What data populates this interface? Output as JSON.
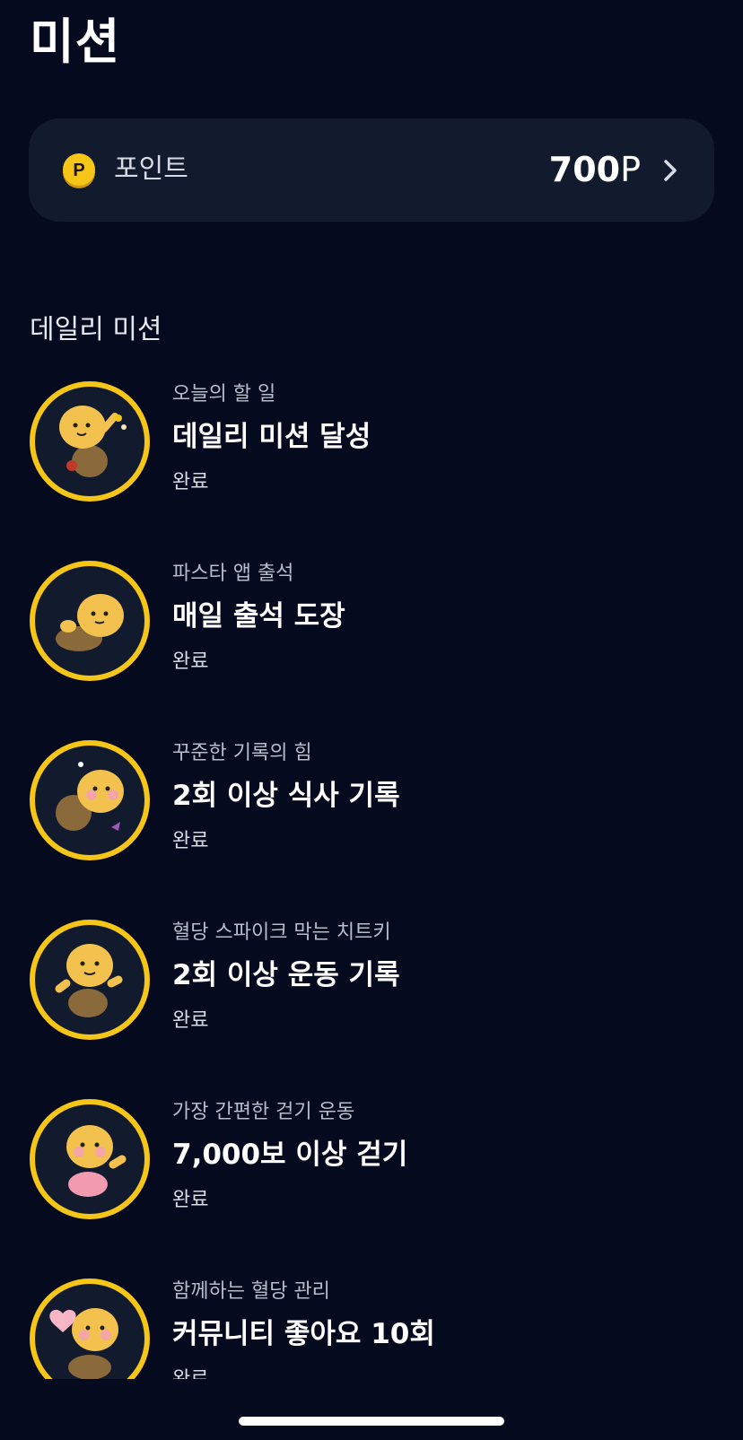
{
  "header": {
    "title": "미션"
  },
  "points": {
    "label": "포인트",
    "amount": "700",
    "unit": "P",
    "coin_letter": "P"
  },
  "daily": {
    "section_title": "데일리 미션",
    "missions": [
      {
        "subtitle": "오늘의 할 일",
        "title": "데일리 미션 달성",
        "status": "완료"
      },
      {
        "subtitle": "파스타 앱 출석",
        "title": "매일 출석 도장",
        "status": "완료"
      },
      {
        "subtitle": "꾸준한 기록의 힘",
        "title": "2회 이상 식사 기록",
        "status": "완료"
      },
      {
        "subtitle": "혈당 스파이크 막는 치트키",
        "title": "2회 이상 운동 기록",
        "status": "완료"
      },
      {
        "subtitle": "가장 간편한 걷기 운동",
        "title": "7,000보 이상 걷기",
        "status": "완료"
      },
      {
        "subtitle": "함께하는 혈당 관리",
        "title": "커뮤니티 좋아요 10회",
        "status": "완료"
      }
    ]
  },
  "colors": {
    "background": "#050a1e",
    "card": "#121a2d",
    "accent_ring": "#f5c518",
    "character": "#f2c14e"
  }
}
